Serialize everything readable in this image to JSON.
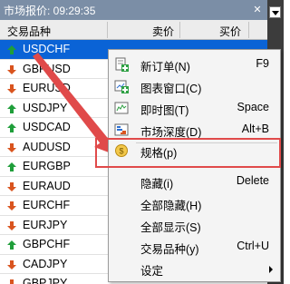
{
  "titlebar": {
    "title": "市场报价: 09:29:35",
    "close": "✕"
  },
  "header": {
    "symbol": "交易品种",
    "sell": "卖价",
    "buy": "买价"
  },
  "rows": [
    {
      "symbol": "USDCHF",
      "dir": "up",
      "selected": true
    },
    {
      "symbol": "GBPUSD",
      "dir": "down"
    },
    {
      "symbol": "EURUSD",
      "dir": "down"
    },
    {
      "symbol": "USDJPY",
      "dir": "up"
    },
    {
      "symbol": "USDCAD",
      "dir": "up"
    },
    {
      "symbol": "AUDUSD",
      "dir": "down"
    },
    {
      "symbol": "EURGBP",
      "dir": "up"
    },
    {
      "symbol": "EURAUD",
      "dir": "down"
    },
    {
      "symbol": "EURCHF",
      "dir": "down"
    },
    {
      "symbol": "EURJPY",
      "dir": "down"
    },
    {
      "symbol": "GBPCHF",
      "dir": "up"
    },
    {
      "symbol": "CADJPY",
      "dir": "down"
    },
    {
      "symbol": "GBPJPY",
      "dir": "down"
    }
  ],
  "menu": {
    "items": [
      {
        "label": "新订单(N)",
        "shortcut": "F9",
        "icon": "new-order-icon"
      },
      {
        "label": "图表窗口(C)",
        "shortcut": "",
        "icon": "chart-window-icon"
      },
      {
        "label": "即时图(T)",
        "shortcut": "Space",
        "icon": "tick-chart-icon"
      },
      {
        "label": "市场深度(D)",
        "shortcut": "Alt+B",
        "icon": "market-depth-icon"
      },
      {
        "label": "规格(p)",
        "shortcut": "",
        "icon": "specification-icon"
      },
      {
        "label": "隐藏(i)",
        "shortcut": "Delete",
        "icon": ""
      },
      {
        "label": "全部隐藏(H)",
        "shortcut": "",
        "icon": ""
      },
      {
        "label": "全部显示(S)",
        "shortcut": "",
        "icon": ""
      },
      {
        "label": "交易品种(y)",
        "shortcut": "Ctrl+U",
        "icon": ""
      },
      {
        "label": "设定",
        "shortcut": "",
        "icon": ""
      }
    ]
  },
  "colors": {
    "up": "#1f9e3a",
    "down": "#d9541e",
    "highlight": "#e04a4a",
    "selected": "#0a63d6"
  }
}
